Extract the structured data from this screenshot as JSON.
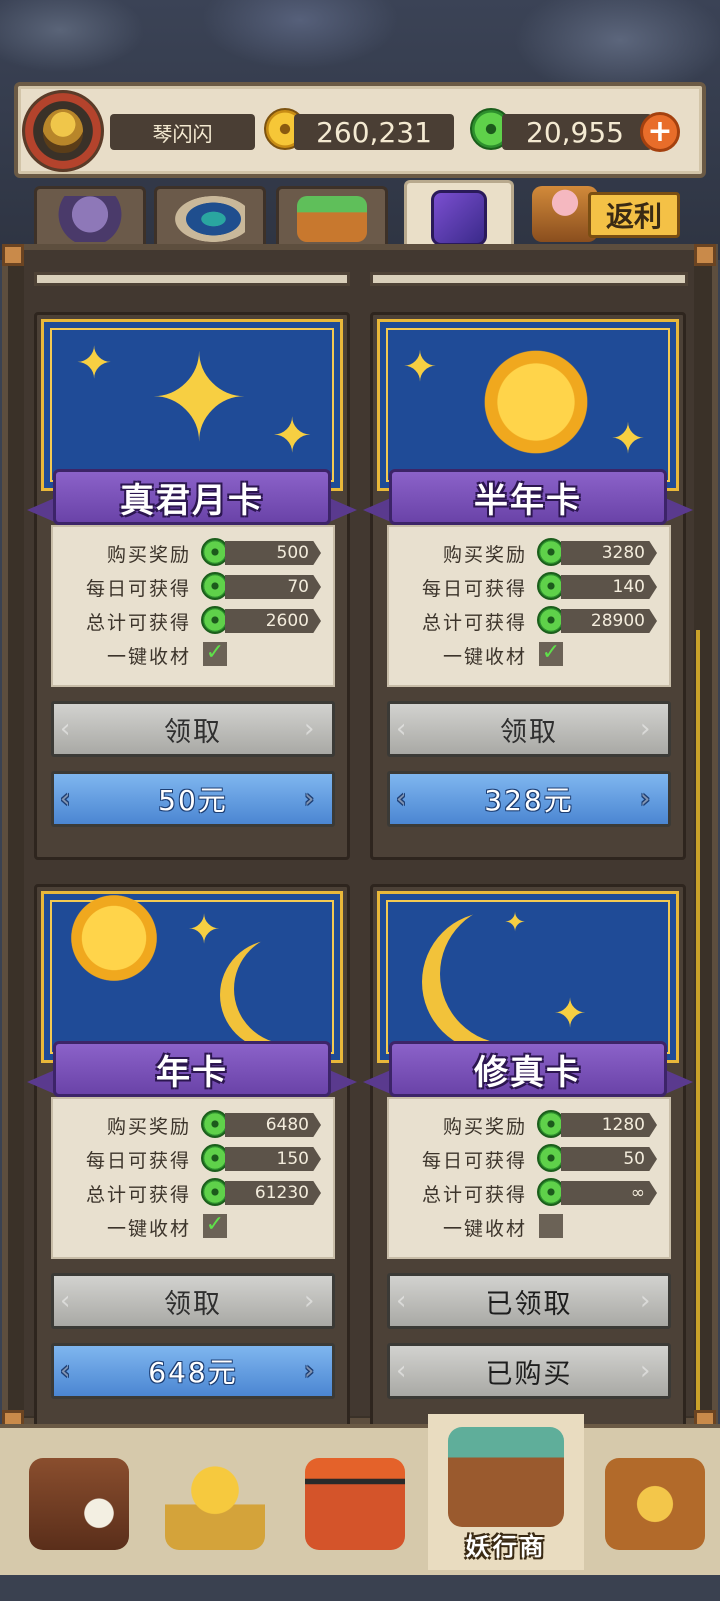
{
  "header": {
    "player_name": "琴闪闪",
    "gold": "260,231",
    "jade": "20,955",
    "plus": "+"
  },
  "tabs": [
    {
      "name": "monster-tab",
      "icon": "demon-icon"
    },
    {
      "name": "feather-tab",
      "icon": "peacock-feather-icon"
    },
    {
      "name": "coin-chest-tab",
      "icon": "coin-chest-icon"
    },
    {
      "name": "card-tab",
      "icon": "moon-card-icon",
      "active": true
    }
  ],
  "rebate": {
    "label": "返利",
    "icon": "pig-chest-icon"
  },
  "cards": [
    {
      "title": "真君月卡",
      "rows": [
        {
          "label": "购买奖励",
          "value": "500"
        },
        {
          "label": "每日可获得",
          "value": "70"
        },
        {
          "label": "总计可获得",
          "value": "2600"
        }
      ],
      "auto_collect_label": "一键收材",
      "auto_collect": true,
      "claim_label": "领取",
      "price_label": "50元"
    },
    {
      "title": "半年卡",
      "rows": [
        {
          "label": "购买奖励",
          "value": "3280"
        },
        {
          "label": "每日可获得",
          "value": "140"
        },
        {
          "label": "总计可获得",
          "value": "28900"
        }
      ],
      "auto_collect_label": "一键收材",
      "auto_collect": true,
      "claim_label": "领取",
      "price_label": "328元"
    },
    {
      "title": "年卡",
      "rows": [
        {
          "label": "购买奖励",
          "value": "6480"
        },
        {
          "label": "每日可获得",
          "value": "150"
        },
        {
          "label": "总计可获得",
          "value": "61230"
        }
      ],
      "auto_collect_label": "一键收材",
      "auto_collect": true,
      "claim_label": "领取",
      "price_label": "648元"
    },
    {
      "title": "修真卡",
      "rows": [
        {
          "label": "购买奖励",
          "value": "1280"
        },
        {
          "label": "每日可获得",
          "value": "50"
        },
        {
          "label": "总计可获得",
          "value": "∞"
        }
      ],
      "auto_collect_label": "一键收材",
      "auto_collect": false,
      "claim_label": "已领取",
      "price_label": "已购买"
    }
  ],
  "icons": {
    "check": "✓",
    "chev_left": "‹",
    "chev_right": "›"
  },
  "bottom_nav": [
    {
      "icon": "treasure-chest-clock-icon"
    },
    {
      "icon": "golden-star-trophy-icon"
    },
    {
      "icon": "demon-gate-icon"
    },
    {
      "icon": "merchant-stall-icon",
      "label": "妖行商",
      "active": true
    },
    {
      "icon": "ornate-book-icon"
    }
  ],
  "colors": {
    "ribbon": "#6a43a8",
    "price_button": "#4b86d2",
    "card_art": "#1f4b97",
    "gold": "#f6c737",
    "jade": "#5fd14a"
  }
}
